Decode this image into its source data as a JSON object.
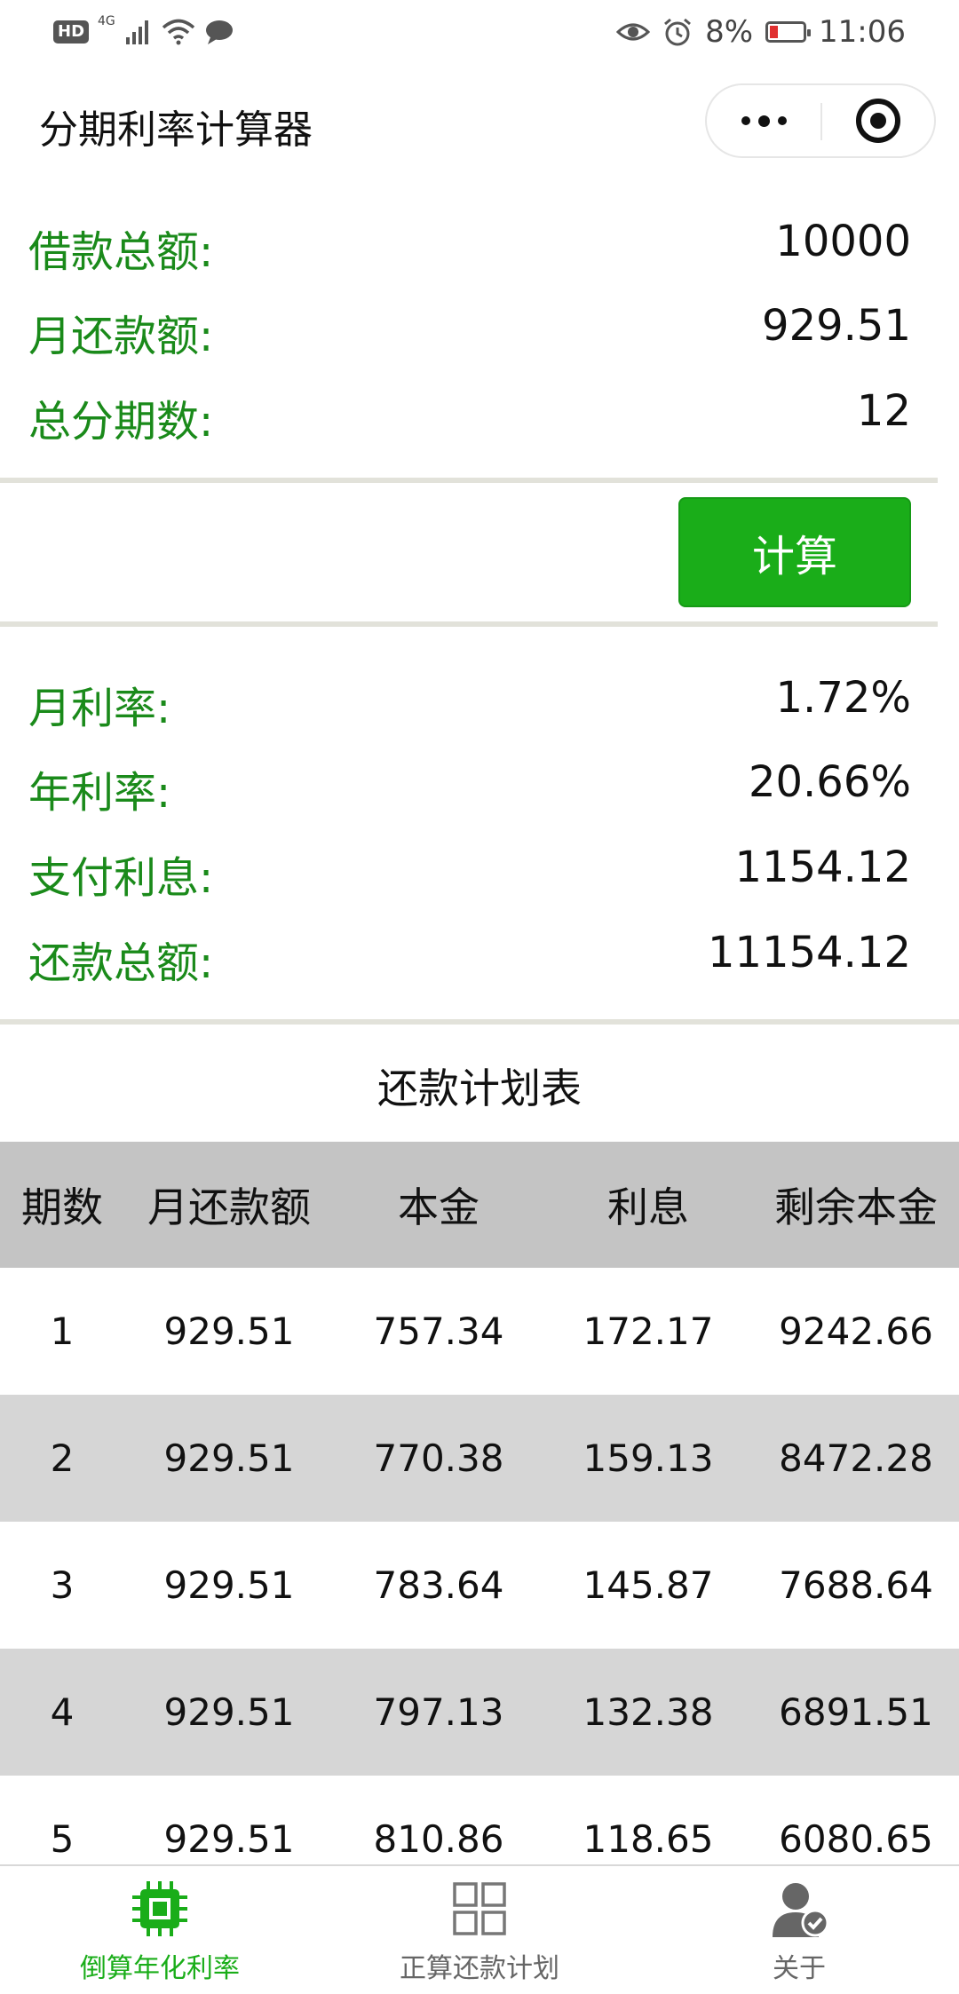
{
  "status_bar": {
    "left_badge": "HD",
    "signal_label": "4G",
    "battery": "8%",
    "time": "11:06"
  },
  "title_bar": {
    "title": "分期利率计算器"
  },
  "form": {
    "loan_total": {
      "label": "借款总额:",
      "value": "10000"
    },
    "monthly_payment": {
      "label": "月还款额:",
      "value": "929.51"
    },
    "installments": {
      "label": "总分期数:",
      "value": "12"
    },
    "calculate_label": "计算"
  },
  "results": {
    "monthly_rate": {
      "label": "月利率:",
      "value": "1.72%"
    },
    "annual_rate": {
      "label": "年利率:",
      "value": "20.66%"
    },
    "interest_paid": {
      "label": "支付利息:",
      "value": "1154.12"
    },
    "repay_total": {
      "label": "还款总额:",
      "value": "11154.12"
    }
  },
  "schedule": {
    "title": "还款计划表",
    "columns": [
      "期数",
      "月还款额",
      "本金",
      "利息",
      "剩余本金"
    ],
    "rows": [
      [
        "1",
        "929.51",
        "757.34",
        "172.17",
        "9242.66"
      ],
      [
        "2",
        "929.51",
        "770.38",
        "159.13",
        "8472.28"
      ],
      [
        "3",
        "929.51",
        "783.64",
        "145.87",
        "7688.64"
      ],
      [
        "4",
        "929.51",
        "797.13",
        "132.38",
        "6891.51"
      ],
      [
        "5",
        "929.51",
        "810.86",
        "118.65",
        "6080.65"
      ]
    ]
  },
  "tab_bar": {
    "tabs": [
      {
        "label": "倒算年化利率",
        "icon": "chip-icon",
        "active": true
      },
      {
        "label": "正算还款计划",
        "icon": "grid-icon",
        "active": false
      },
      {
        "label": "关于",
        "icon": "user-check-icon",
        "active": false
      }
    ]
  },
  "colors": {
    "accent": "#1aad19",
    "label_green": "#1a8a1a",
    "header_gray": "#c4c4c4",
    "row_alt_gray": "#d6d6d6"
  }
}
